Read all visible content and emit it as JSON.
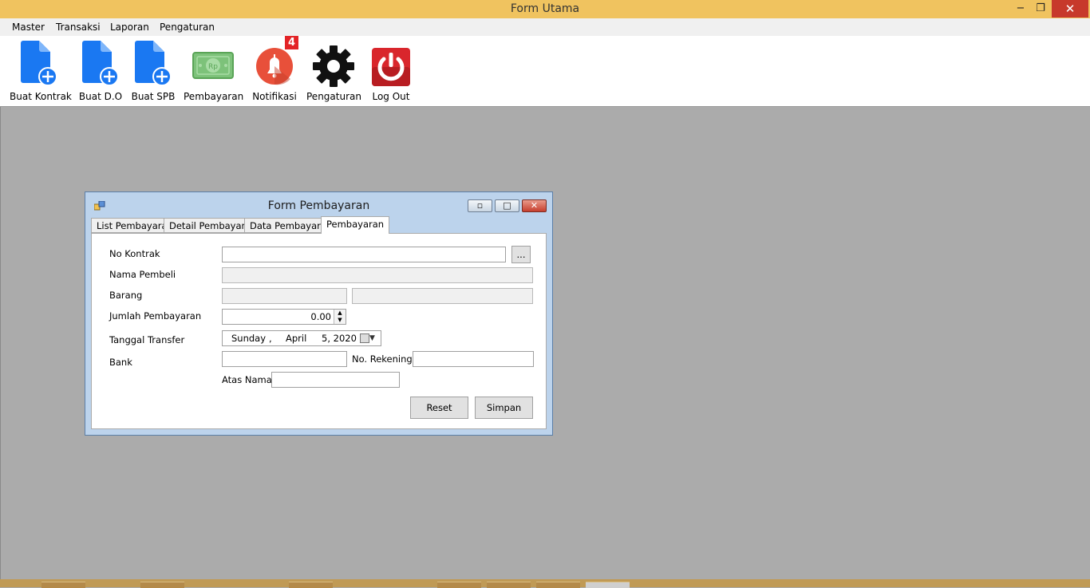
{
  "window": {
    "title": "Form Utama",
    "min": "−",
    "max": "❐",
    "close": "✕"
  },
  "menu": [
    "Master",
    "Transaksi",
    "Laporan",
    "Pengaturan"
  ],
  "toolbar": {
    "buat_kontrak": "Buat Kontrak",
    "buat_do": "Buat D.O",
    "buat_spb": "Buat SPB",
    "pembayaran": "Pembayaran",
    "notifikasi": "Notifikasi",
    "notif_count": "4",
    "pengaturan": "Pengaturan",
    "logout": "Log Out",
    "money_symbol": "Rp"
  },
  "child": {
    "title": "Form Pembayaran",
    "tabs": [
      "List Pembayaran",
      "Detail Pembayaran",
      "Data Pembayaran",
      "Pembayaran"
    ],
    "active_tab": "Pembayaran",
    "fields": {
      "no_kontrak": {
        "label": "No Kontrak",
        "value": "",
        "browse": "..."
      },
      "nama_pembeli": {
        "label": "Nama Pembeli",
        "value": ""
      },
      "barang": {
        "label": "Barang",
        "value1": "",
        "value2": ""
      },
      "jumlah": {
        "label": "Jumlah Pembayaran",
        "value": "0.00"
      },
      "tanggal": {
        "label": "Tanggal Transfer",
        "day": "Sunday",
        "sep": ",",
        "month": "April",
        "date": "5, 2020"
      },
      "bank": {
        "label": "Bank",
        "value": ""
      },
      "no_rekening": {
        "label": "No. Rekening",
        "value": ""
      },
      "atas_nama": {
        "label": "Atas Nama",
        "value": ""
      }
    },
    "buttons": {
      "reset": "Reset",
      "simpan": "Simpan"
    }
  },
  "colors": {
    "titlebar": "#f0c35f",
    "mdi_background": "#ababab",
    "doc_icon": "#1a78f2",
    "bell": "#e8503a",
    "power": "#d9262c"
  }
}
